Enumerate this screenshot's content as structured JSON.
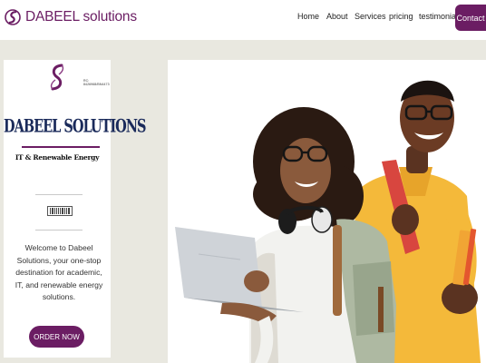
{
  "header": {
    "brand_name": "DABEEL solutions",
    "brand_logo_icon": "s-ribbon-logo-icon",
    "nav": [
      {
        "label": "Home"
      },
      {
        "label": "About"
      },
      {
        "label": "Services"
      },
      {
        "label": "pricing"
      },
      {
        "label": "testimonials"
      }
    ],
    "contact_label": "Contact"
  },
  "card": {
    "logo": {
      "reg_no": "RC: 8426968/BN4473",
      "title": "DABEEL SOLUTIONS",
      "subtitle": "IT & Renewable Energy"
    },
    "barcode_icon": "barcode-icon",
    "welcome_text": "Welcome to Dabeel Solutions, your one-stop destination for academic, IT, and renewable energy solutions.",
    "order_label": "ORDER NOW"
  },
  "hero": {
    "image": "students-with-laptop-photo"
  },
  "colors": {
    "brand": "#6b1d63",
    "page_bg": "#e9e8e0",
    "title_navy": "#1a2a5a"
  }
}
